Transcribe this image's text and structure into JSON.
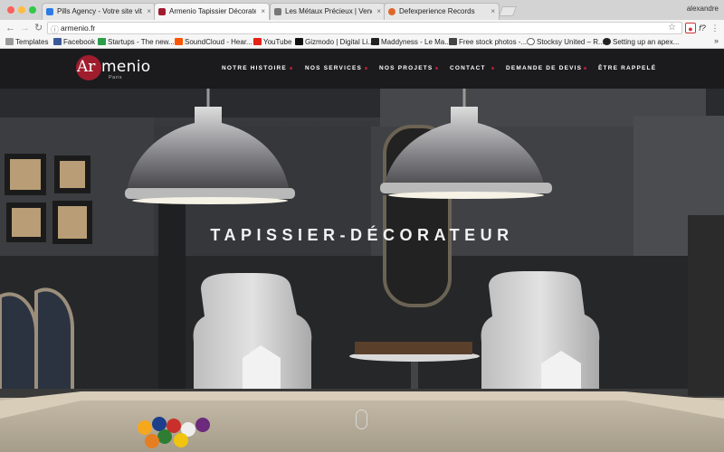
{
  "browser": {
    "user": "alexandre",
    "tabs": [
      {
        "title": "Pills Agency - Votre site vitrine",
        "favicon_color": "#2c7be5",
        "active": false
      },
      {
        "title": "Armenio Tapissier Décorateur",
        "favicon_color": "#a01d2e",
        "active": true
      },
      {
        "title": "Les Métaux Précieux | Vendez",
        "favicon_color": "#777777",
        "active": false
      },
      {
        "title": "Defexperience Records",
        "favicon_color": "#e0672a",
        "active": false
      }
    ],
    "url": "armenio.fr",
    "bookmarks": [
      {
        "label": "Templates",
        "icon": "folder-icon",
        "color": "#8a8a8a"
      },
      {
        "label": "Facebook",
        "icon": "facebook-icon",
        "color": "#3b5998"
      },
      {
        "label": "Startups - The new...",
        "icon": "yc-icon",
        "color": "#f26522"
      },
      {
        "label": "SoundCloud - Hear...",
        "icon": "soundcloud-icon",
        "color": "#ff5500"
      },
      {
        "label": "YouTube",
        "icon": "youtube-icon",
        "color": "#e62117"
      },
      {
        "label": "Gizmodo | Digital Li...",
        "icon": "gizmodo-icon",
        "color": "#111111"
      },
      {
        "label": "Maddyness - Le Ma...",
        "icon": "maddyness-icon",
        "color": "#222222"
      },
      {
        "label": "Free stock photos -...",
        "icon": "camera-icon",
        "color": "#444444"
      },
      {
        "label": "Stocksy United – R...",
        "icon": "stocksy-icon",
        "color": "#666666"
      },
      {
        "label": "Setting up an apex...",
        "icon": "github-icon",
        "color": "#222222"
      }
    ],
    "more_label": "»"
  },
  "site": {
    "logo": {
      "ar": "Ar",
      "rest": "menio",
      "sub": "Paris",
      "color": "#a01d2e"
    },
    "nav": [
      "NOTRE HISTOIRE",
      "NOS SERVICES",
      "NOS PROJETS",
      "CONTACT",
      "DEMANDE DE DEVIS",
      "ÊTRE RAPPELÉ"
    ],
    "accent": "#b01e35",
    "hero_title": "TAPISSIER-DÉCORATEUR"
  }
}
